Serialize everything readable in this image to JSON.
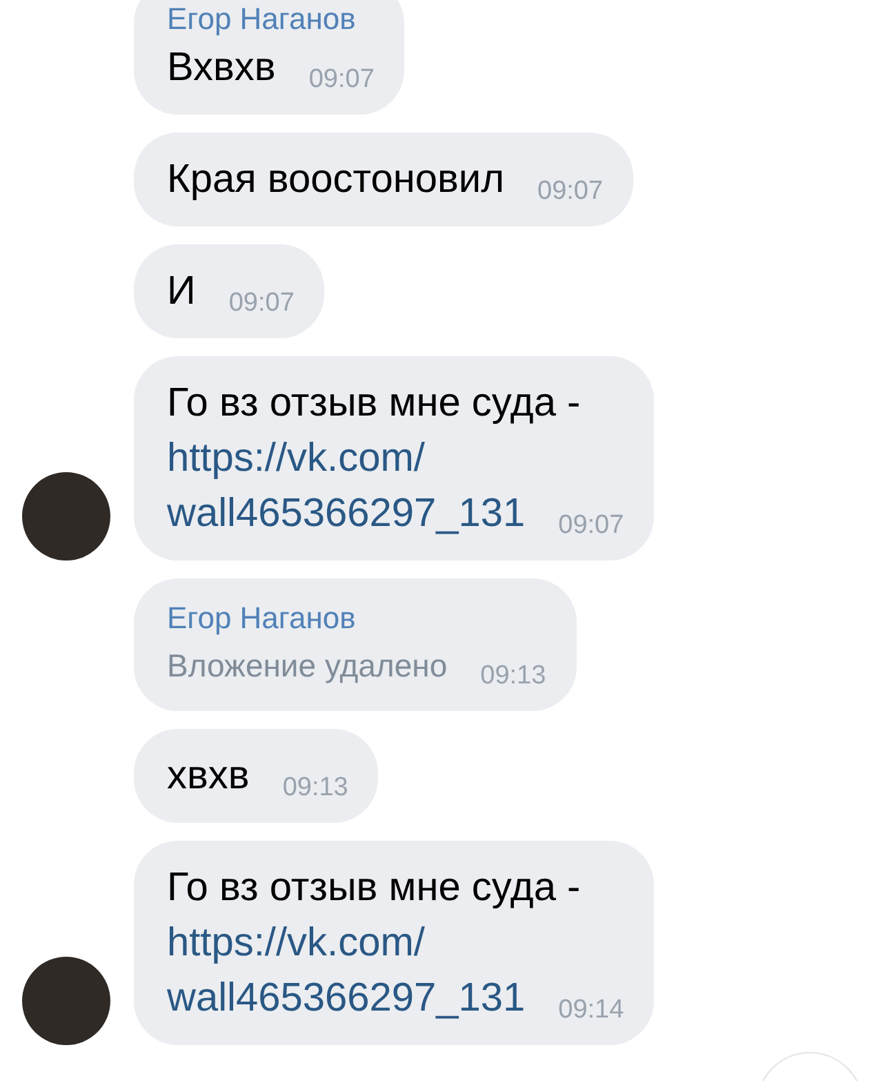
{
  "messages": [
    {
      "kind": "text",
      "sender": "Егор Наганов",
      "text": "Вхвхв",
      "time": "09:07",
      "avatar": false
    },
    {
      "kind": "text",
      "text": "Края воостоновил",
      "time": "09:07",
      "avatar": false
    },
    {
      "kind": "text",
      "text": "И",
      "time": "09:07",
      "avatar": false
    },
    {
      "kind": "link",
      "text": "Го вз отзыв мне суда -",
      "link_lines": [
        "https://vk.com/",
        "wall465366297_131"
      ],
      "time": "09:07",
      "avatar": true
    },
    {
      "kind": "deleted",
      "sender": "Егор Наганов",
      "text": "Вложение удалено",
      "time": "09:13",
      "avatar": false
    },
    {
      "kind": "text",
      "text": "хвхв",
      "time": "09:13",
      "avatar": false
    },
    {
      "kind": "link",
      "text": "Го вз отзыв мне суда -",
      "link_lines": [
        "https://vk.com/",
        "wall465366297_131"
      ],
      "time": "09:14",
      "avatar": true
    }
  ]
}
